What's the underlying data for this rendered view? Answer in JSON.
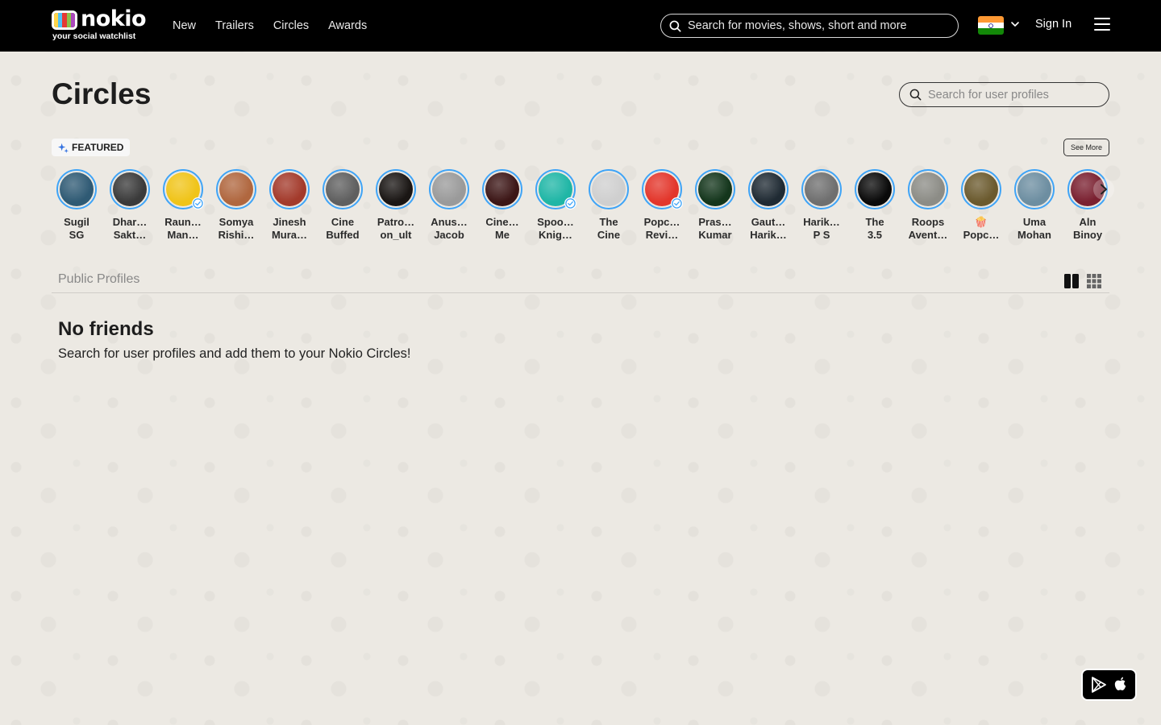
{
  "header": {
    "logo_word": "nokio",
    "logo_tagline": "your social watchlist",
    "nav": [
      {
        "label": "New"
      },
      {
        "label": "Trailers"
      },
      {
        "label": "Circles"
      },
      {
        "label": "Awards"
      }
    ],
    "search_placeholder": "Search for movies, shows, short and more",
    "sign_in": "Sign In"
  },
  "page": {
    "title": "Circles",
    "profile_search_placeholder": "Search for user profiles",
    "featured_label": "FEATURED",
    "see_more": "See More",
    "section_title": "Public Profiles",
    "empty_title": "No friends",
    "empty_subtitle": "Search for user profiles and add them to your Nokio Circles!"
  },
  "featured_profiles": [
    {
      "line1": "Sugil",
      "line2": "SG",
      "color": "#2f5a74",
      "verified": false
    },
    {
      "line1": "Dhar…",
      "line2": "Sakt…",
      "color": "#3a3a3a",
      "verified": false
    },
    {
      "line1": "Raun…",
      "line2": "Man…",
      "color": "#f0c419",
      "verified": true
    },
    {
      "line1": "Somya",
      "line2": "Rishi…",
      "color": "#b0673f",
      "verified": false
    },
    {
      "line1": "Jinesh",
      "line2": "Mura…",
      "color": "#a33a2b",
      "verified": false
    },
    {
      "line1": "Cine",
      "line2": "Buffed",
      "color": "#5f5f5f",
      "verified": false
    },
    {
      "line1": "Patro…",
      "line2": "on_ult",
      "color": "#1a1614",
      "verified": false
    },
    {
      "line1": "Anus…",
      "line2": "Jacob",
      "color": "#9a9a9a",
      "verified": false
    },
    {
      "line1": "Cine…",
      "line2": "Me",
      "color": "#3c1616",
      "verified": false
    },
    {
      "line1": "Spoo…",
      "line2": "Knig…",
      "color": "#1fb6a6",
      "verified": true
    },
    {
      "line1": "The",
      "line2": "Cine",
      "color": "#cfcfcf",
      "verified": false
    },
    {
      "line1": "Popc…",
      "line2": "Revi…",
      "color": "#e3362b",
      "verified": true
    },
    {
      "line1": "Pras…",
      "line2": "Kumar",
      "color": "#14361c",
      "verified": false
    },
    {
      "line1": "Gaut…",
      "line2": "Harik…",
      "color": "#1f2a33",
      "verified": false
    },
    {
      "line1": "Harik…",
      "line2": "P S",
      "color": "#6f6f6f",
      "verified": false
    },
    {
      "line1": "The",
      "line2": "3.5",
      "color": "#0a0a0a",
      "verified": false
    },
    {
      "line1": "Roops",
      "line2": "Avent…",
      "color": "#8c8c86",
      "verified": false
    },
    {
      "line1": "🍿",
      "line2": "Popc…",
      "color": "#6b5a2e",
      "verified": false
    },
    {
      "line1": "Uma",
      "line2": "Mohan",
      "color": "#6d8ea1",
      "verified": false
    },
    {
      "line1": "Aln",
      "line2": "Binoy",
      "color": "#7a2030",
      "verified": false
    }
  ]
}
